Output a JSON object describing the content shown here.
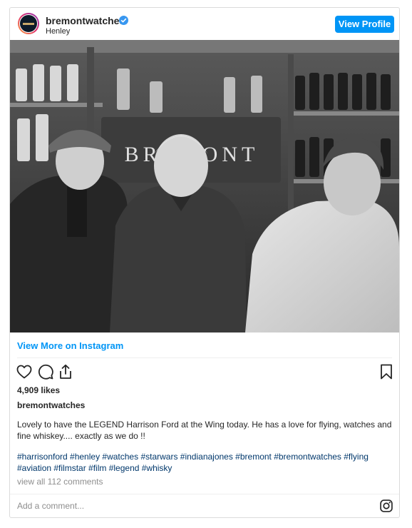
{
  "post": {
    "username": "bremontwatches",
    "location": "Henley",
    "view_profile_label": "View Profile",
    "view_more_label": "View More on Instagram",
    "likes": "4,909 likes",
    "caption_username": "bremontwatches",
    "caption_text": "Lovely to have the LEGEND Harrison Ford at the Wing today. He has a love for flying, watches and fine whiskey.... exactly as we do !!",
    "hashtags_line1": "#harrisonford #henley #watches #starwars #indianajones #bremont #bremontwatches #flying",
    "hashtags_line2": "#aviation #filmstar #film #legend #whisky",
    "view_comments": "view all 112 comments",
    "add_comment_placeholder": "Add a comment...",
    "sign_text": "BREMONT"
  },
  "colors": {
    "accent": "#0095f6",
    "hashtag": "#00376b",
    "muted": "#8e8e8e"
  },
  "icons": [
    "verified-badge-icon",
    "heart-icon",
    "comment-icon",
    "share-icon",
    "bookmark-icon",
    "instagram-icon"
  ]
}
